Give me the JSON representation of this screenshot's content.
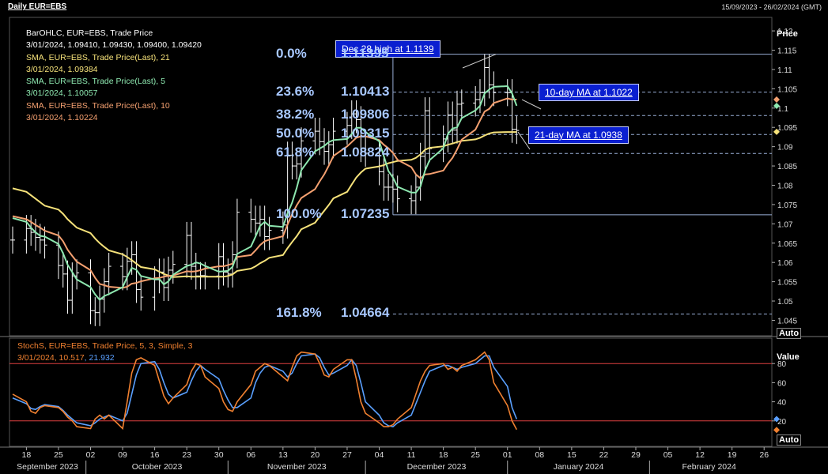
{
  "header": {
    "title": "Daily EUR=EBS",
    "range": "15/09/2023 - 26/02/2024 (GMT)"
  },
  "legend": [
    {
      "text": "BarOHLC, EUR=EBS, Trade Price",
      "color": "#ffffff"
    },
    {
      "text": "3/01/2024, 1.09410, 1.09430, 1.09400, 1.09420",
      "color": "#ffffff"
    },
    {
      "text": "SMA, EUR=EBS, Trade Price(Last),  21",
      "color": "#f6e27a"
    },
    {
      "text": "3/01/2024, 1.09384",
      "color": "#f6e27a"
    },
    {
      "text": "SMA, EUR=EBS, Trade Price(Last),  5",
      "color": "#8ee8b0"
    },
    {
      "text": "3/01/2024, 1.10057",
      "color": "#8ee8b0"
    },
    {
      "text": "SMA, EUR=EBS, Trade Price(Last),  10",
      "color": "#f4a070"
    },
    {
      "text": "3/01/2024, 1.10224",
      "color": "#f4a070"
    }
  ],
  "stoch_legend": {
    "line1": "StochS, EUR=EBS, Trade Price,  5, 3, Simple, 3",
    "line2_date": "3/01/2024, ",
    "line2_k": "10.517",
    "line2_sep": ", ",
    "line2_d": "21.932",
    "k_color": "#f08030",
    "d_color": "#5aa0ff"
  },
  "callouts": {
    "dec28": "Dec 28 high at 1.1139",
    "ma10": "10-day MA at 1.1022",
    "ma21": "21-day MA at 1.0938"
  },
  "fib_labels": [
    {
      "pct": "0.0%",
      "val": "1.11395",
      "level": 1.11395
    },
    {
      "pct": "23.6%",
      "val": "1.10413",
      "level": 1.10413
    },
    {
      "pct": "38.2%",
      "val": "1.09806",
      "level": 1.09806
    },
    {
      "pct": "50.0%",
      "val": "1.09315",
      "level": 1.09315
    },
    {
      "pct": "61.8%",
      "val": "1.08824",
      "level": 1.08824
    },
    {
      "pct": "100.0%",
      "val": "1.07235",
      "level": 1.07235
    },
    {
      "pct": "161.8%",
      "val": "1.04664",
      "level": 1.04664
    }
  ],
  "price_axis": {
    "title": "Price",
    "ticks": [
      "1.12",
      "1.115",
      "1.11",
      "1.105",
      "1.1",
      "1.095",
      "1.09",
      "1.085",
      "1.08",
      "1.075",
      "1.07",
      "1.065",
      "1.06",
      "1.055",
      "1.05",
      "1.045"
    ],
    "range": [
      1.041,
      1.1235
    ]
  },
  "value_axis": {
    "title": "Value",
    "ticks": [
      "80",
      "60",
      "40",
      "20"
    ],
    "range": [
      0,
      100
    ],
    "levels": [
      80,
      20
    ]
  },
  "auto_label": "Auto",
  "x_axis": {
    "days": [
      "18",
      "25",
      "02",
      "09",
      "16",
      "23",
      "30",
      "06",
      "13",
      "20",
      "27",
      "04",
      "11",
      "18",
      "25",
      "01",
      "08",
      "15",
      "22",
      "29",
      "05",
      "12",
      "19",
      "26"
    ],
    "months": [
      "September 2023",
      "October 2023",
      "November 2023",
      "December 2023",
      "January 2024",
      "February 2024"
    ]
  },
  "chart_data": {
    "type": "line",
    "title": "Daily EUR=EBS",
    "date_range": "15/09/2023 - 26/02/2024",
    "dates": [
      "2023-09-15",
      "2023-09-18",
      "2023-09-19",
      "2023-09-20",
      "2023-09-21",
      "2023-09-22",
      "2023-09-25",
      "2023-09-26",
      "2023-09-27",
      "2023-09-28",
      "2023-09-29",
      "2023-10-02",
      "2023-10-03",
      "2023-10-04",
      "2023-10-05",
      "2023-10-06",
      "2023-10-09",
      "2023-10-10",
      "2023-10-11",
      "2023-10-12",
      "2023-10-13",
      "2023-10-16",
      "2023-10-17",
      "2023-10-18",
      "2023-10-19",
      "2023-10-20",
      "2023-10-23",
      "2023-10-24",
      "2023-10-25",
      "2023-10-26",
      "2023-10-27",
      "2023-10-30",
      "2023-10-31",
      "2023-11-01",
      "2023-11-02",
      "2023-11-03",
      "2023-11-06",
      "2023-11-07",
      "2023-11-08",
      "2023-11-09",
      "2023-11-10",
      "2023-11-13",
      "2023-11-14",
      "2023-11-15",
      "2023-11-16",
      "2023-11-17",
      "2023-11-20",
      "2023-11-21",
      "2023-11-22",
      "2023-11-23",
      "2023-11-24",
      "2023-11-27",
      "2023-11-28",
      "2023-11-29",
      "2023-11-30",
      "2023-12-01",
      "2023-12-04",
      "2023-12-05",
      "2023-12-06",
      "2023-12-07",
      "2023-12-08",
      "2023-12-11",
      "2023-12-12",
      "2023-12-13",
      "2023-12-14",
      "2023-12-15",
      "2023-12-18",
      "2023-12-19",
      "2023-12-20",
      "2023-12-21",
      "2023-12-22",
      "2023-12-25",
      "2023-12-26",
      "2023-12-27",
      "2023-12-28",
      "2023-12-29",
      "2024-01-01",
      "2024-01-02",
      "2024-01-03"
    ],
    "close": [
      1.0658,
      1.0688,
      1.0678,
      1.0665,
      1.0658,
      1.0645,
      1.0592,
      1.057,
      1.0502,
      1.0565,
      1.0573,
      1.0475,
      1.047,
      1.0505,
      1.055,
      1.059,
      1.0563,
      1.0603,
      1.062,
      1.053,
      1.051,
      1.0555,
      1.0575,
      1.0535,
      1.058,
      1.0595,
      1.067,
      1.059,
      1.0565,
      1.0566,
      1.0565,
      1.0615,
      1.0575,
      1.057,
      1.062,
      1.073,
      1.0712,
      1.0702,
      1.0712,
      1.0667,
      1.0683,
      1.0697,
      1.0878,
      1.085,
      1.0855,
      1.0915,
      1.094,
      1.0913,
      1.0888,
      1.0905,
      1.094,
      1.0955,
      1.0985,
      1.097,
      1.0895,
      1.0883,
      1.0835,
      1.0795,
      1.0795,
      1.079,
      1.0765,
      1.076,
      1.0795,
      1.0875,
      1.0993,
      1.0895,
      1.092,
      1.0982,
      1.0943,
      1.101,
      1.1013,
      1.1022,
      1.104,
      1.1105,
      1.106,
      1.104,
      1.104,
      1.0945,
      1.0942
    ],
    "sma5": [
      1.0715,
      1.0705,
      1.069,
      1.0678,
      1.0669,
      1.0667,
      1.0648,
      1.0624,
      1.0594,
      1.0575,
      1.0556,
      1.0536,
      1.0517,
      1.0503,
      1.0513,
      1.0518,
      1.0536,
      1.0562,
      1.0586,
      1.0581,
      1.0565,
      1.0556,
      1.0557,
      1.0543,
      1.0551,
      1.0568,
      1.0591,
      1.0594,
      1.06,
      1.0597,
      1.0591,
      1.0576,
      1.0577,
      1.0578,
      1.0589,
      1.0622,
      1.0641,
      1.0667,
      1.0695,
      1.0705,
      1.0695,
      1.0692,
      1.0727,
      1.0755,
      1.0793,
      1.0839,
      1.0888,
      1.0895,
      1.0902,
      1.0912,
      1.0917,
      1.092,
      1.0933,
      1.0949,
      1.0949,
      1.0938,
      1.0914,
      1.0876,
      1.0837,
      1.082,
      1.0796,
      1.0781,
      1.0781,
      1.0797,
      1.0838,
      1.0865,
      1.0896,
      1.0933,
      1.0947,
      1.095,
      1.0974,
      1.0994,
      1.1006,
      1.1038,
      1.1048,
      1.1055,
      1.1057,
      1.1038,
      1.1006
    ],
    "sma10": [
      1.072,
      1.0712,
      1.0705,
      1.0697,
      1.069,
      1.0682,
      1.067,
      1.0655,
      1.0633,
      1.0617,
      1.0602,
      1.058,
      1.056,
      1.0544,
      1.0541,
      1.0537,
      1.0534,
      1.0537,
      1.0545,
      1.0547,
      1.0551,
      1.0559,
      1.056,
      1.0563,
      1.0565,
      1.0566,
      1.0577,
      1.0576,
      1.0577,
      1.058,
      1.0584,
      1.059,
      1.059,
      1.0593,
      1.0597,
      1.0614,
      1.0619,
      1.0631,
      1.0645,
      1.0655,
      1.0659,
      1.0668,
      1.0698,
      1.0725,
      1.0748,
      1.0767,
      1.079,
      1.081,
      1.0828,
      1.0851,
      1.0876,
      1.0901,
      1.0912,
      1.0923,
      1.0927,
      1.0927,
      1.0917,
      1.0905,
      1.0896,
      1.0884,
      1.0866,
      1.0847,
      1.0828,
      1.0818,
      1.0828,
      1.0829,
      1.0838,
      1.0856,
      1.0871,
      1.0893,
      1.0918,
      1.0944,
      1.0968,
      1.0991,
      1.0998,
      1.1013,
      1.1025,
      1.1022,
      1.1022
    ],
    "sma21": [
      1.0792,
      1.0783,
      1.0774,
      1.0765,
      1.0756,
      1.0747,
      1.0737,
      1.0726,
      1.0712,
      1.0701,
      1.069,
      1.0676,
      1.0662,
      1.065,
      1.064,
      1.0631,
      1.0621,
      1.0614,
      1.0606,
      1.0597,
      1.0588,
      1.0582,
      1.0576,
      1.057,
      1.0566,
      1.0562,
      1.0564,
      1.0563,
      1.0563,
      1.0563,
      1.0563,
      1.0563,
      1.0563,
      1.0565,
      1.0569,
      1.0578,
      1.0584,
      1.059,
      1.0598,
      1.0604,
      1.0612,
      1.0619,
      1.0637,
      1.0653,
      1.0668,
      1.0686,
      1.0703,
      1.0719,
      1.0734,
      1.0749,
      1.0766,
      1.0783,
      1.0802,
      1.082,
      1.0833,
      1.0843,
      1.0849,
      1.0852,
      1.0857,
      1.086,
      1.0863,
      1.0866,
      1.0871,
      1.088,
      1.0892,
      1.0897,
      1.0901,
      1.0905,
      1.0908,
      1.0912,
      1.0915,
      1.0919,
      1.0923,
      1.0929,
      1.0934,
      1.0937,
      1.0938,
      1.0938,
      1.0938
    ],
    "stoch_k": [
      48,
      40,
      30,
      28,
      34,
      36,
      34,
      30,
      24,
      20,
      14,
      12,
      22,
      26,
      22,
      26,
      12,
      40,
      70,
      84,
      86,
      78,
      62,
      46,
      38,
      44,
      58,
      72,
      80,
      78,
      66,
      54,
      40,
      32,
      30,
      40,
      58,
      72,
      76,
      80,
      78,
      66,
      62,
      76,
      88,
      92,
      90,
      80,
      68,
      66,
      74,
      84,
      84,
      64,
      40,
      28,
      18,
      14,
      14,
      16,
      22,
      34,
      48,
      62,
      72,
      78,
      80,
      74,
      76,
      72,
      78,
      84,
      88,
      92,
      84,
      60,
      36,
      20,
      11
    ],
    "stoch_d": [
      44,
      38,
      33,
      32,
      35,
      37,
      35,
      31,
      26,
      22,
      18,
      15,
      18,
      22,
      24,
      26,
      20,
      28,
      48,
      68,
      80,
      82,
      74,
      60,
      48,
      44,
      50,
      62,
      72,
      78,
      74,
      64,
      52,
      42,
      34,
      34,
      44,
      60,
      70,
      76,
      78,
      72,
      66,
      70,
      80,
      88,
      90,
      86,
      76,
      68,
      70,
      78,
      84,
      78,
      60,
      40,
      26,
      18,
      15,
      14,
      18,
      26,
      38,
      50,
      62,
      72,
      78,
      78,
      76,
      74,
      76,
      80,
      84,
      88,
      88,
      76,
      56,
      34,
      22
    ],
    "series": [
      {
        "name": "BarOHLC, EUR=EBS, Trade Price",
        "values_key": "close"
      },
      {
        "name": "SMA, EUR=EBS, Trade Price(Last),  21",
        "values_key": "sma21"
      },
      {
        "name": "SMA, EUR=EBS, Trade Price(Last),  5",
        "values_key": "sma5"
      },
      {
        "name": "SMA, EUR=EBS, Trade Price(Last),  10",
        "values_key": "sma10"
      },
      {
        "name": "StochS, EUR=EBS, Trade Price,  5, 3, Simple, 3",
        "values_key": "stoch_k"
      }
    ],
    "fibonacci_levels": [
      1.11395,
      1.10413,
      1.09806,
      1.09315,
      1.08824,
      1.07235,
      1.04664
    ],
    "ylim": [
      1.041,
      1.1235
    ],
    "stoch_ylim": [
      0,
      100
    ]
  },
  "colors": {
    "background": "#000000",
    "bars": "#ffffff",
    "sma21": "#f6e27a",
    "sma5": "#8ee8b0",
    "sma10": "#f4a070",
    "stoch_k": "#f08030",
    "stoch_d": "#5aa0ff",
    "stoch_band": "#e04040",
    "fib": "#a8c8ff",
    "callout_bg": "#0a1fd0"
  }
}
